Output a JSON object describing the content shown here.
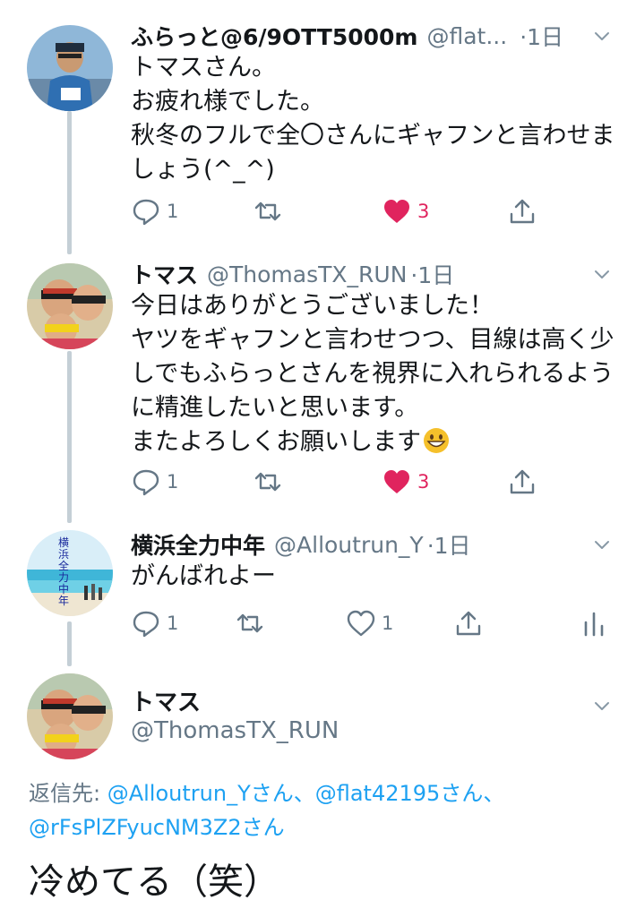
{
  "tweets": [
    {
      "name": "ふらっと@6/9OTT5000m",
      "handle": "@flat...",
      "time": "·1日",
      "lines": [
        "トマスさん。",
        "お疲れ様でした。",
        "秋冬のフルで全〇さんにギャフンと言わせま",
        "しょう(^_^)"
      ],
      "reply_count": "1",
      "retweet_count": "",
      "like_count": "3",
      "liked": true
    },
    {
      "name": "トマス",
      "handle": "@ThomasTX_RUN",
      "time": "·1日",
      "lines": [
        "今日はありがとうございました！",
        "ヤツをギャフンと言わせつつ、目線は高く少",
        "しでもふらっとさんを視界に入れられるよう",
        "に精進したいと思います。",
        "またよろしくお願いします"
      ],
      "emoji": "grinning-face-emoji",
      "reply_count": "1",
      "retweet_count": "",
      "like_count": "3",
      "liked": true
    },
    {
      "name": "横浜全力中年",
      "handle": "@Alloutrun_Y",
      "time": "·1日",
      "avatar_text": "横浜全力中年",
      "lines": [
        "がんばれよー"
      ],
      "reply_count": "1",
      "retweet_count": "",
      "like_count": "1",
      "liked": false
    }
  ],
  "main_tweet": {
    "name": "トマス",
    "handle": "@ThomasTX_RUN",
    "reply_label": "返信先: ",
    "mentions": [
      "@Alloutrun_Yさん、",
      "@flat42195さん、",
      "@rFsPlZFyucNM3Z2さん"
    ],
    "text": "冷めてる（笑）"
  },
  "colors": {
    "text": "#14171a",
    "secondary": "#657786",
    "link": "#1da1f2",
    "like": "#e0245e",
    "thread_line": "#c4cfd6"
  },
  "icons": [
    "reply-icon",
    "retweet-icon",
    "like-icon",
    "share-icon",
    "analytics-icon",
    "chevron-down-icon"
  ]
}
